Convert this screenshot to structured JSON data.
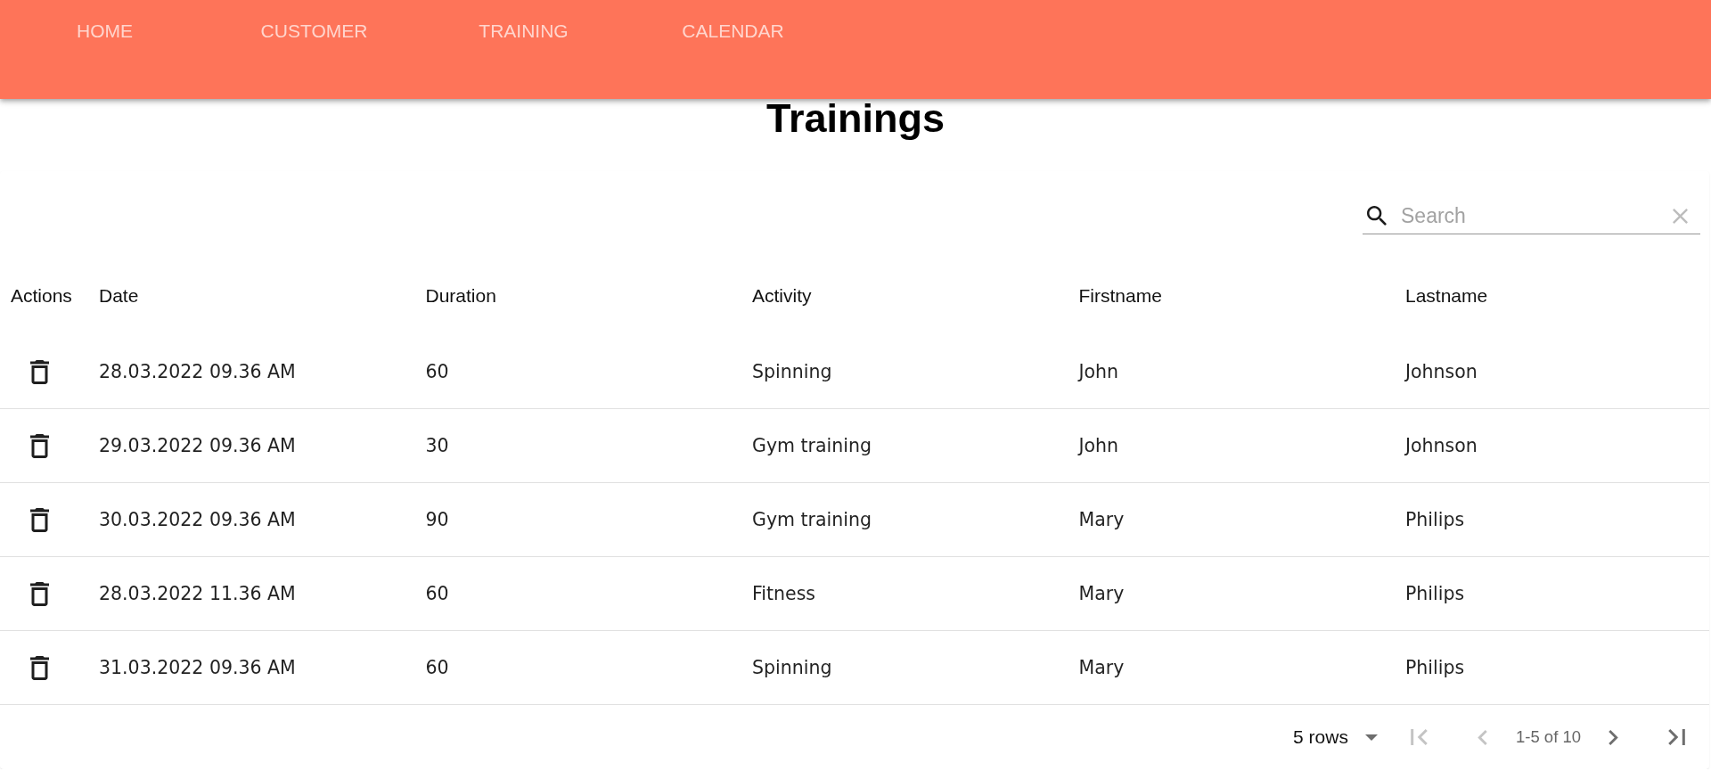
{
  "nav": {
    "items": [
      {
        "label": "HOME"
      },
      {
        "label": "CUSTOMER"
      },
      {
        "label": "TRAINING"
      },
      {
        "label": "CALENDAR"
      }
    ]
  },
  "page_title": "Trainings",
  "search": {
    "placeholder": "Search",
    "clear_disabled": true
  },
  "table": {
    "columns": [
      "Actions",
      "Date",
      "Duration",
      "Activity",
      "Firstname",
      "Lastname"
    ],
    "rows": [
      {
        "cells": [
          "",
          "28.03.2022 09.36 AM",
          "60",
          "Spinning",
          "John",
          "Johnson"
        ]
      },
      {
        "cells": [
          "",
          "29.03.2022 09.36 AM",
          "30",
          "Gym training",
          "John",
          "Johnson"
        ]
      },
      {
        "cells": [
          "",
          "30.03.2022 09.36 AM",
          "90",
          "Gym training",
          "Mary",
          "Philips"
        ]
      },
      {
        "cells": [
          "",
          "28.03.2022 11.36 AM",
          "60",
          "Fitness",
          "Mary",
          "Philips"
        ]
      },
      {
        "cells": [
          "",
          "31.03.2022 09.36 AM",
          "60",
          "Spinning",
          "Mary",
          "Philips"
        ]
      }
    ]
  },
  "pagination": {
    "rows_per_page": "5 rows",
    "controls": [
      {
        "kind": "first",
        "disabled": true
      },
      {
        "kind": "previous",
        "disabled": true
      },
      {
        "kind": "range",
        "text": "1-5 of 10"
      },
      {
        "kind": "next",
        "disabled": false
      },
      {
        "kind": "last",
        "disabled": false
      }
    ]
  }
}
